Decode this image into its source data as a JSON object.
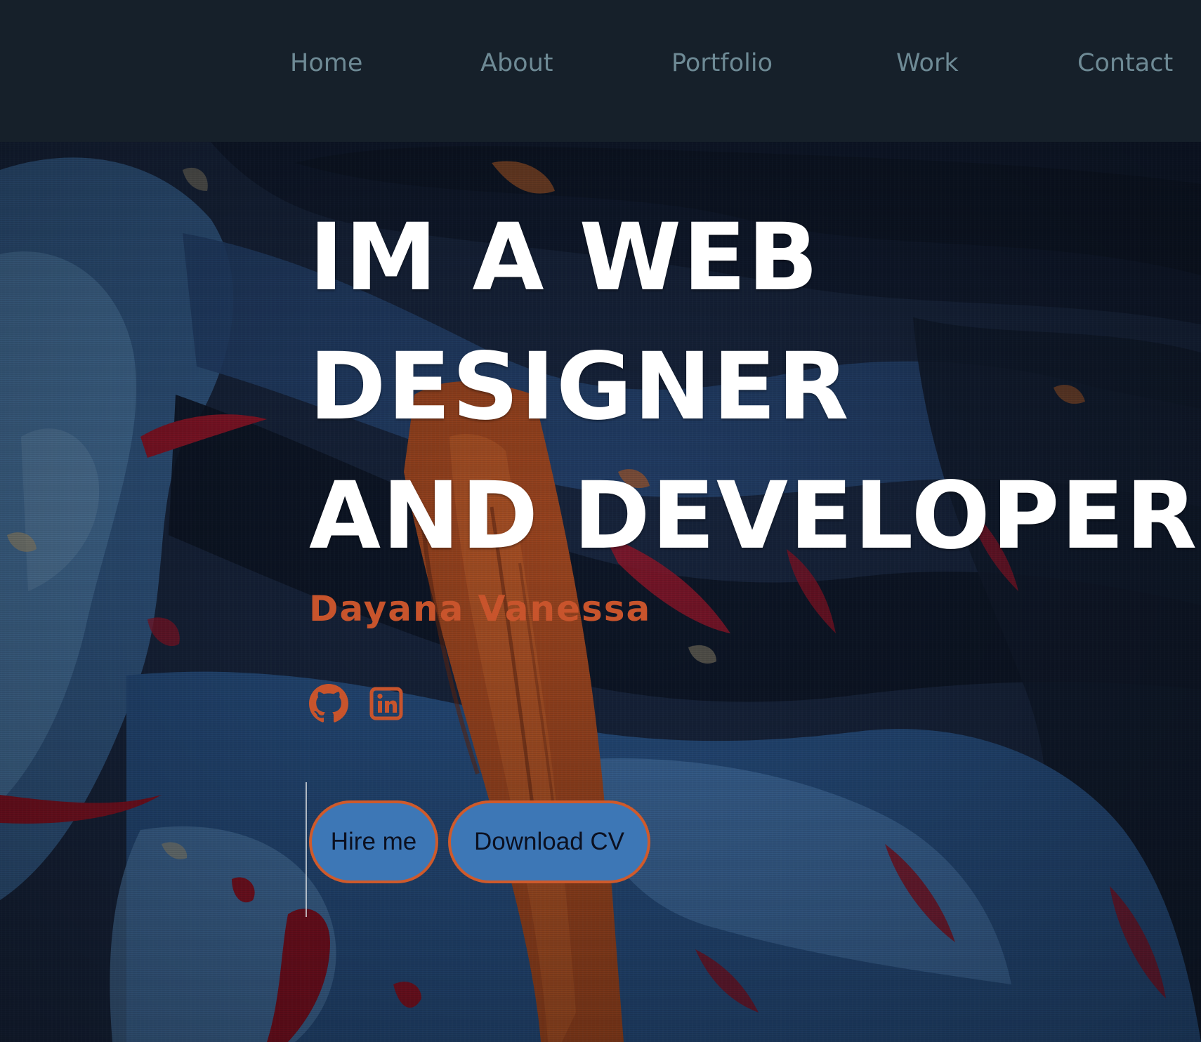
{
  "nav": {
    "items": [
      {
        "label": "Home"
      },
      {
        "label": "About"
      },
      {
        "label": "Portfolio"
      },
      {
        "label": "Work"
      },
      {
        "label": "Contact"
      }
    ]
  },
  "hero": {
    "headline": [
      "IM A WEB",
      "DESIGNER",
      "AND DEVELOPER"
    ],
    "name": "Dayana Vanessa",
    "social_icons": [
      "github-icon",
      "linkedin-icon"
    ],
    "buttons": {
      "hire": "Hire me",
      "download": "Download CV"
    }
  },
  "colors": {
    "nav_background": "#16202a",
    "nav_text": "#6e8a95",
    "headline": "#ffffff",
    "accent_orange": "#c8542c",
    "button_fill": "#3d77b6",
    "button_border": "#cf5a2b"
  }
}
